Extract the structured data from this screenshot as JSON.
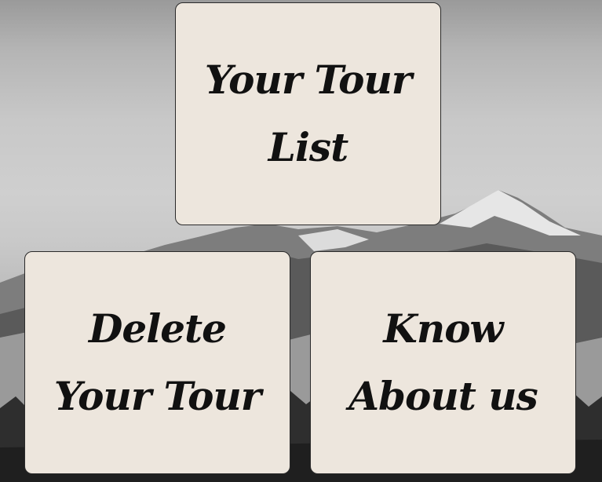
{
  "cards": {
    "tour_list": {
      "line1": "Your Tour",
      "line2": "List"
    },
    "delete_tour": {
      "line1": "Delete",
      "line2": "Your Tour"
    },
    "about_us": {
      "line1": "Know",
      "line2": "About us"
    }
  },
  "colors": {
    "card_background": "#ede6dd",
    "card_border": "#2a2a2a",
    "text": "#111111"
  },
  "background": {
    "description_icon": "mountain-landscape-grayscale"
  }
}
